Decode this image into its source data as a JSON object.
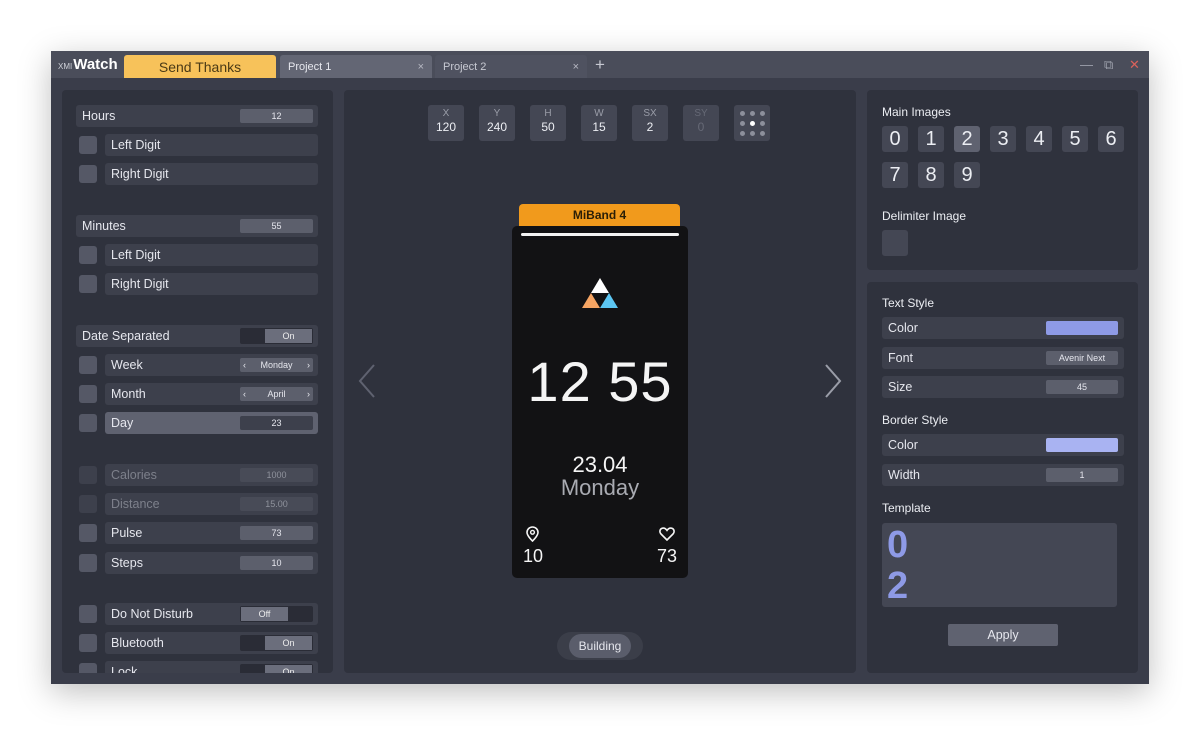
{
  "app": {
    "logo_small": "XMI",
    "logo_big": "Watch",
    "send_thanks": "Send Thanks"
  },
  "tabs": [
    {
      "label": "Project 1",
      "close": "×"
    },
    {
      "label": "Project 2",
      "close": "×"
    }
  ],
  "new_tab": "+",
  "window_controls": {
    "minimize": "—",
    "restore": "⧉",
    "close": "✕"
  },
  "left": {
    "hours": {
      "label": "Hours",
      "value": "12"
    },
    "hours_left": "Left Digit",
    "hours_right": "Right Digit",
    "minutes": {
      "label": "Minutes",
      "value": "55"
    },
    "minutes_left": "Left Digit",
    "minutes_right": "Right Digit",
    "date_separated": {
      "label": "Date Separated",
      "state": "On"
    },
    "week": {
      "label": "Week",
      "value": "Monday"
    },
    "month": {
      "label": "Month",
      "value": "April"
    },
    "day": {
      "label": "Day",
      "value": "23"
    },
    "calories": {
      "label": "Calories",
      "value": "1000"
    },
    "distance": {
      "label": "Distance",
      "value": "15.00"
    },
    "pulse": {
      "label": "Pulse",
      "value": "73"
    },
    "steps": {
      "label": "Steps",
      "value": "10"
    },
    "dnd": {
      "label": "Do Not Disturb",
      "state": "Off"
    },
    "bluetooth": {
      "label": "Bluetooth",
      "state": "On"
    },
    "lock": {
      "label": "Lock",
      "state": "On"
    },
    "arrow_left": "‹",
    "arrow_right": "›"
  },
  "center": {
    "coords": [
      {
        "key": "X",
        "value": "120"
      },
      {
        "key": "Y",
        "value": "240"
      },
      {
        "key": "H",
        "value": "50"
      },
      {
        "key": "W",
        "value": "15"
      },
      {
        "key": "SX",
        "value": "2"
      },
      {
        "key": "SY",
        "value": "0"
      }
    ],
    "device_name": "MiBand 4",
    "time": "12 55",
    "date": "23.04",
    "weekday": "Monday",
    "steps": "10",
    "pulse": "73",
    "building": "Building"
  },
  "right": {
    "main_images_title": "Main Images",
    "digits": [
      "0",
      "1",
      "2",
      "3",
      "4",
      "5",
      "6",
      "7",
      "8",
      "9"
    ],
    "selected_digit": "2",
    "delimiter_title": "Delimiter Image",
    "text_style_title": "Text Style",
    "text_color_label": "Color",
    "text_color": "#8e9ae6",
    "font_label": "Font",
    "font_value": "Avenir Next",
    "size_label": "Size",
    "size_value": "45",
    "border_style_title": "Border Style",
    "border_color_label": "Color",
    "border_color": "#a9b3f2",
    "width_label": "Width",
    "width_value": "1",
    "template_title": "Template",
    "template_top": "0",
    "template_bottom": "2",
    "apply": "Apply"
  },
  "colors": {
    "accent_orange": "#f19a1c",
    "send_thanks_bg": "#f7c25a"
  },
  "icons": [
    "map-pin-icon",
    "heart-icon",
    "grid-dots-icon",
    "chevron-left-icon",
    "chevron-right-icon",
    "triangle-logo-icon"
  ]
}
